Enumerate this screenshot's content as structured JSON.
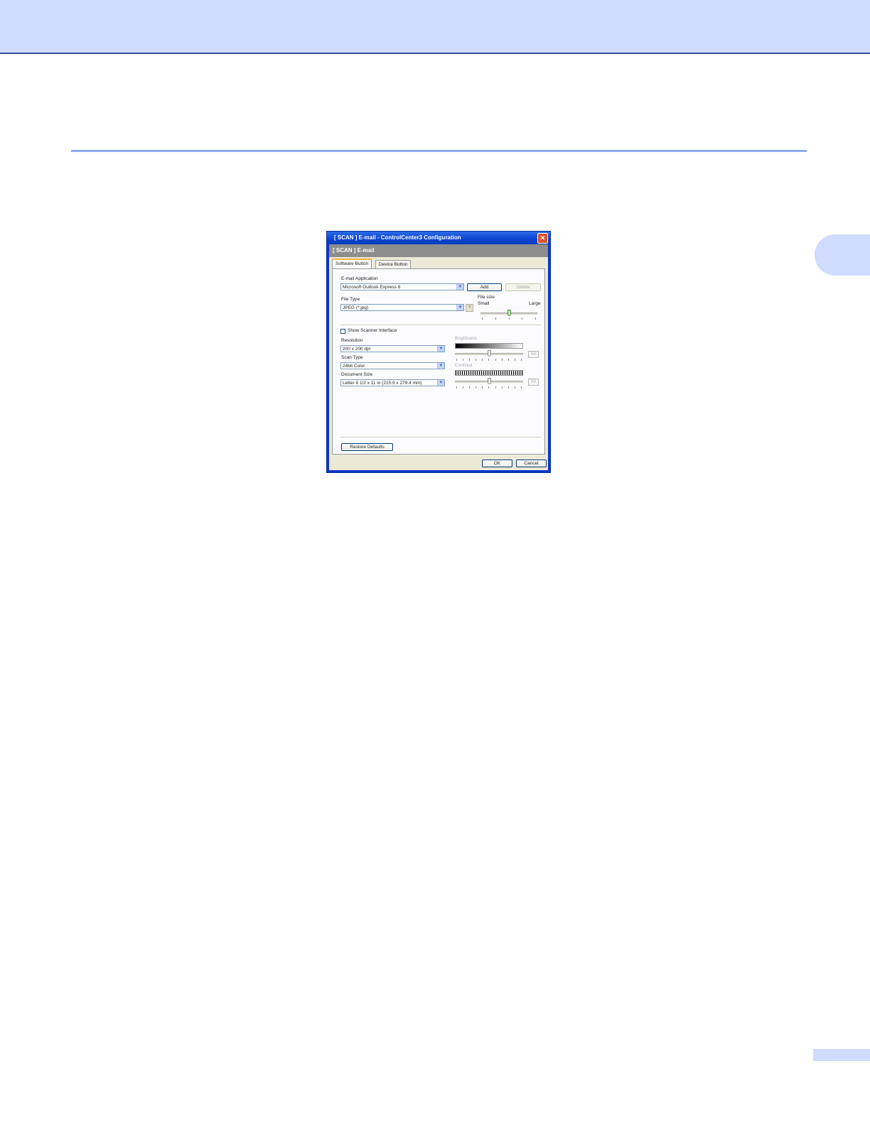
{
  "dialog": {
    "title": "[ SCAN ] E-mail - ControlCenter3 Configuration",
    "close_glyph": "✕",
    "header": "[ SCAN ] E-mail",
    "tabs": [
      {
        "label": "Software Button",
        "active": true
      },
      {
        "label": "Device Button",
        "active": false
      }
    ],
    "email_app": {
      "label": "E-mail Application",
      "value": "Microsoft Outlook Express 6",
      "add_label": "Add",
      "delete_label": "Delete"
    },
    "file_type": {
      "label": "File Type",
      "value": "JPEG (*.jpg)"
    },
    "file_size": {
      "label": "File size",
      "small_label": "Small",
      "large_label": "Large",
      "level_percent": 50
    },
    "show_scanner_interface": {
      "label": "Show Scanner Interface",
      "checked": false
    },
    "resolution": {
      "label": "Resolution",
      "value": "200 x 200 dpi"
    },
    "scan_type": {
      "label": "Scan Type",
      "value": "24bit Color"
    },
    "document_size": {
      "label": "Document Size",
      "value": "Letter 8 1/2 x 11 in (215.9 x 279.4 mm)"
    },
    "brightness": {
      "label": "Brightness",
      "value": "50",
      "level_percent": 50
    },
    "contrast": {
      "label": "Contrast",
      "value": "50",
      "level_percent": 50
    },
    "restore_defaults_label": "Restore Defaults",
    "ok_label": "OK",
    "cancel_label": "Cancel"
  },
  "colors": {
    "header_band": "#cfdcfd",
    "accent_rule": "#8fa8f0",
    "titlebar": "#0b45d3"
  }
}
